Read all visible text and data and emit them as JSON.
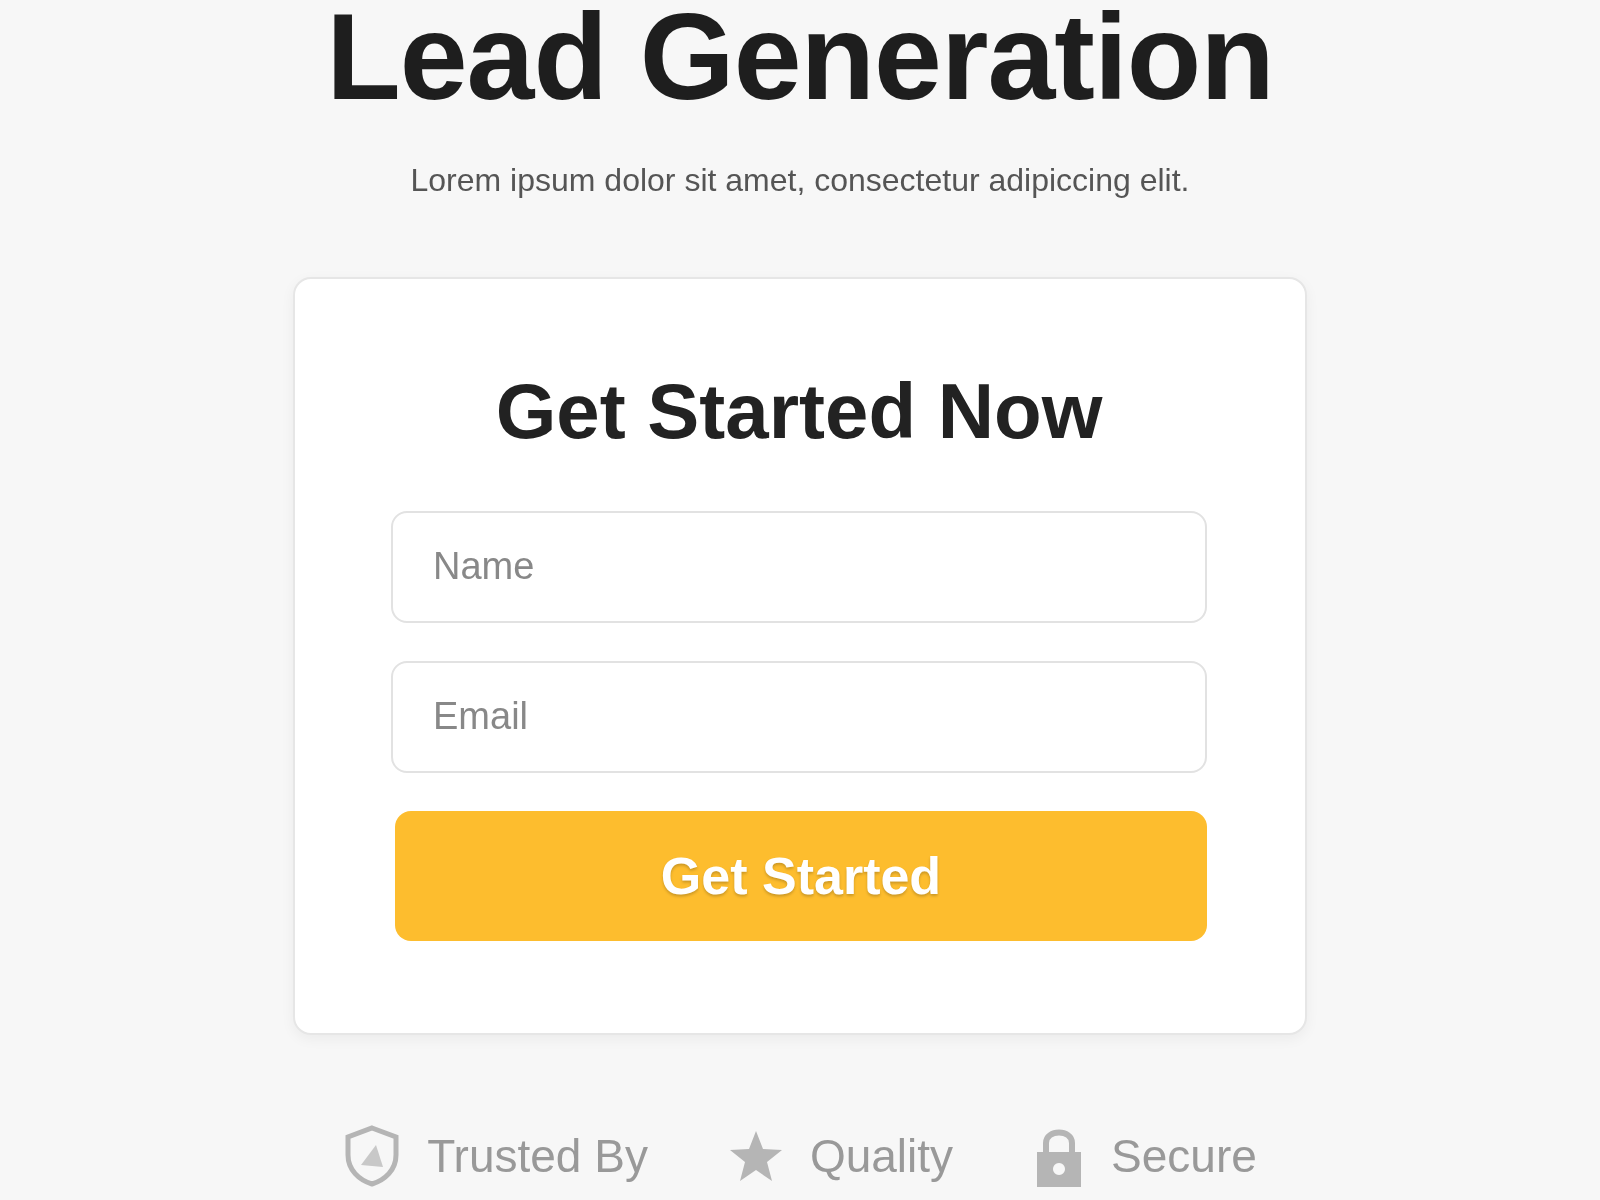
{
  "title": "Lead Generation",
  "subtitle": "Lorem ipsum dolor sit amet, consectetur adipiccing elit.",
  "form": {
    "heading": "Get Started Now",
    "fields": [
      {
        "placeholder": "Name"
      },
      {
        "placeholder": "Email"
      }
    ],
    "button": "Get Started"
  },
  "badges": [
    {
      "kind": "shield",
      "label": "Trusted By"
    },
    {
      "kind": "star",
      "label": "Quality"
    },
    {
      "kind": "lock",
      "label": "Secure"
    }
  ]
}
